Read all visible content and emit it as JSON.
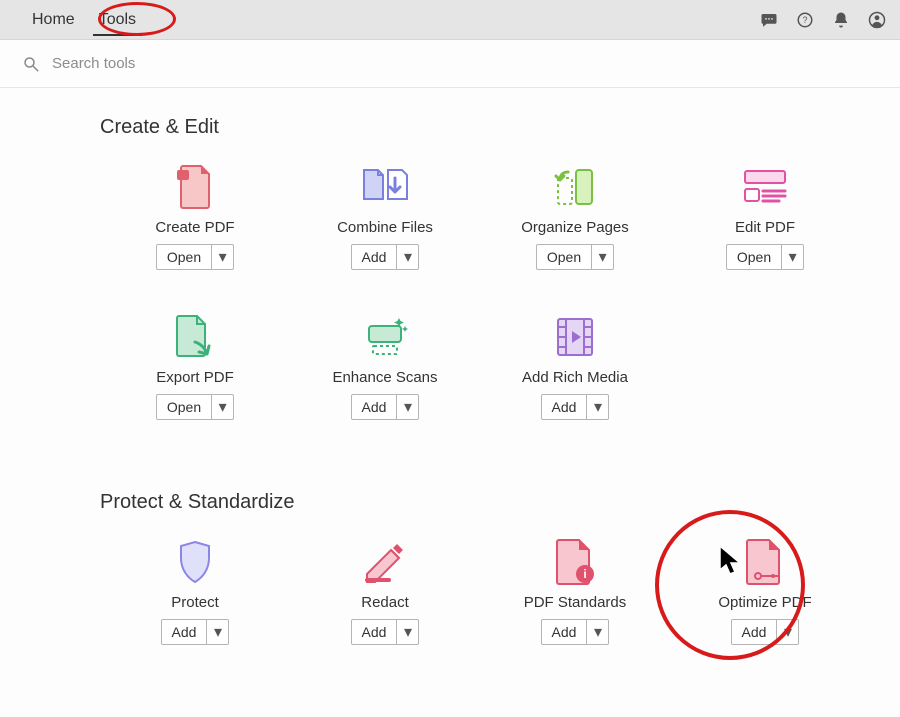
{
  "topbar": {
    "tabs": [
      {
        "label": "Home",
        "active": false
      },
      {
        "label": "Tools",
        "active": true
      }
    ]
  },
  "search": {
    "placeholder": "Search tools"
  },
  "sections": [
    {
      "title": "Create & Edit",
      "tools": [
        {
          "name": "create-pdf",
          "label": "Create PDF",
          "button": "Open",
          "icon": "create-pdf-icon"
        },
        {
          "name": "combine-files",
          "label": "Combine Files",
          "button": "Add",
          "icon": "combine-files-icon"
        },
        {
          "name": "organize-pages",
          "label": "Organize Pages",
          "button": "Open",
          "icon": "organize-pages-icon"
        },
        {
          "name": "edit-pdf",
          "label": "Edit PDF",
          "button": "Open",
          "icon": "edit-pdf-icon"
        },
        {
          "name": "export-pdf",
          "label": "Export PDF",
          "button": "Open",
          "icon": "export-pdf-icon"
        },
        {
          "name": "enhance-scans",
          "label": "Enhance Scans",
          "button": "Add",
          "icon": "enhance-scans-icon"
        },
        {
          "name": "add-rich-media",
          "label": "Add Rich Media",
          "button": "Add",
          "icon": "rich-media-icon"
        }
      ]
    },
    {
      "title": "Protect & Standardize",
      "tools": [
        {
          "name": "protect",
          "label": "Protect",
          "button": "Add",
          "icon": "protect-icon"
        },
        {
          "name": "redact",
          "label": "Redact",
          "button": "Add",
          "icon": "redact-icon"
        },
        {
          "name": "pdf-standards",
          "label": "PDF Standards",
          "button": "Add",
          "icon": "pdf-standards-icon"
        },
        {
          "name": "optimize-pdf",
          "label": "Optimize PDF",
          "button": "Add",
          "icon": "optimize-pdf-icon"
        }
      ]
    }
  ]
}
